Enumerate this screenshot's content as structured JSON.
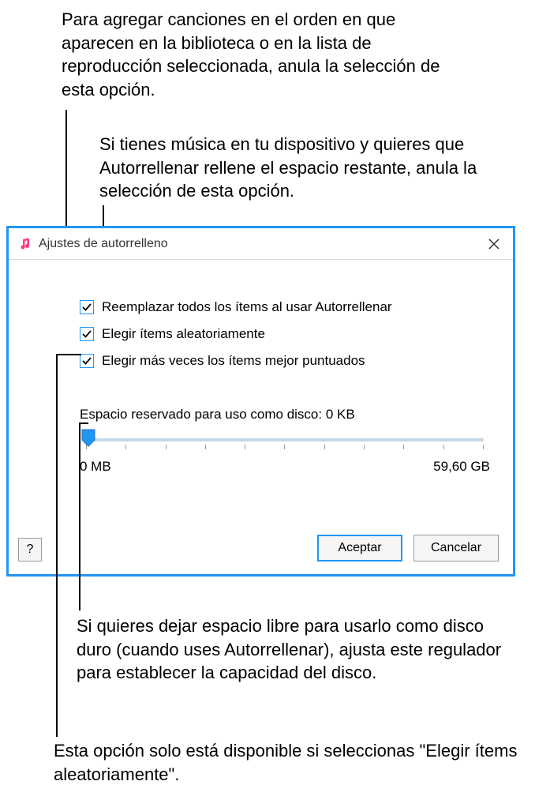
{
  "callouts": {
    "c1": "Para agregar canciones en el orden en que aparecen en la biblioteca o en la lista de reproducción seleccionada, anula la selección de esta opción.",
    "c2": "Si tienes música en tu dispositivo y quieres que Autorrellenar rellene el espacio restante, anula la selección de esta opción.",
    "c3": "Si quieres dejar espacio libre para usarlo como disco duro (cuando uses Autorrellenar), ajusta este regulador para establecer la capacidad del disco.",
    "c4": "Esta opción solo está disponible si seleccionas \"Elegir ítems aleatoriamente\"."
  },
  "dialog": {
    "title": "Ajustes de autorrelleno",
    "checkboxes": {
      "replace": "Reemplazar todos los ítems al usar Autorrellenar",
      "random": "Elegir ítems aleatoriamente",
      "higher_rated": "Elegir más veces los ítems mejor puntuados"
    },
    "slider": {
      "label": "Espacio reservado para uso como disco: 0 KB",
      "min_label": "0 MB",
      "max_label": "59,60 GB"
    },
    "buttons": {
      "ok": "Aceptar",
      "cancel": "Cancelar",
      "help": "?"
    }
  }
}
